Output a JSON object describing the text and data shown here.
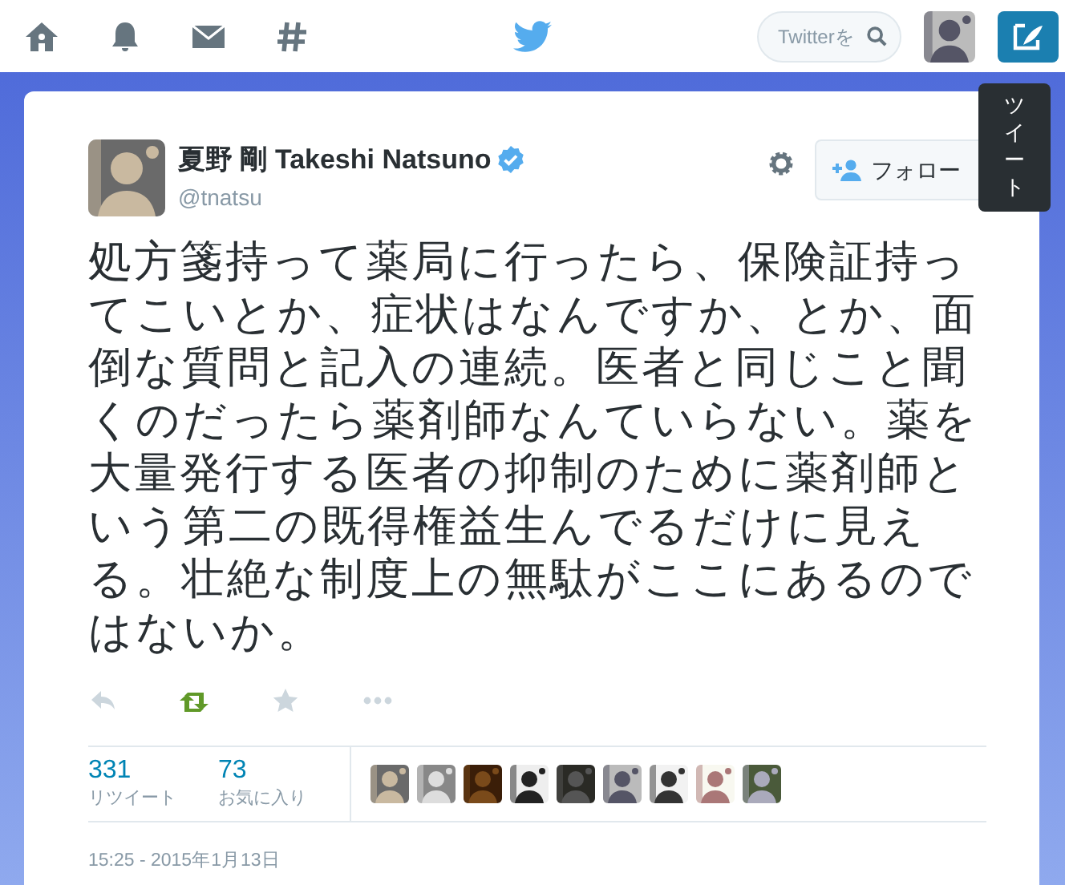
{
  "nav": {
    "search": {
      "placeholder": "Twitterを"
    },
    "tooltip": "ツイート"
  },
  "tweet": {
    "name": "夏野 剛 Takeshi Natsuno",
    "verified": true,
    "handle": "@tnatsu",
    "follow_button": "フォロー",
    "text": "処方箋持って薬局に行ったら、保険証持ってこいとか、症状はなんですか、とか、面倒な質問と記入の連続。医者と同じこと聞くのだったら薬剤師なんていらない。薬を大量発行する医者の抑制のために薬剤師という第二の既得権益生んでるだけに見える。壮絶な制度上の無駄がここにあるのではないか。",
    "actions": {
      "retweeted": true,
      "favorited": false
    },
    "stats": [
      {
        "value": "331",
        "label": "リツイート"
      },
      {
        "value": "73",
        "label": "お気に入り"
      }
    ],
    "timestamp": "15:25 - 2015年1月13日"
  }
}
